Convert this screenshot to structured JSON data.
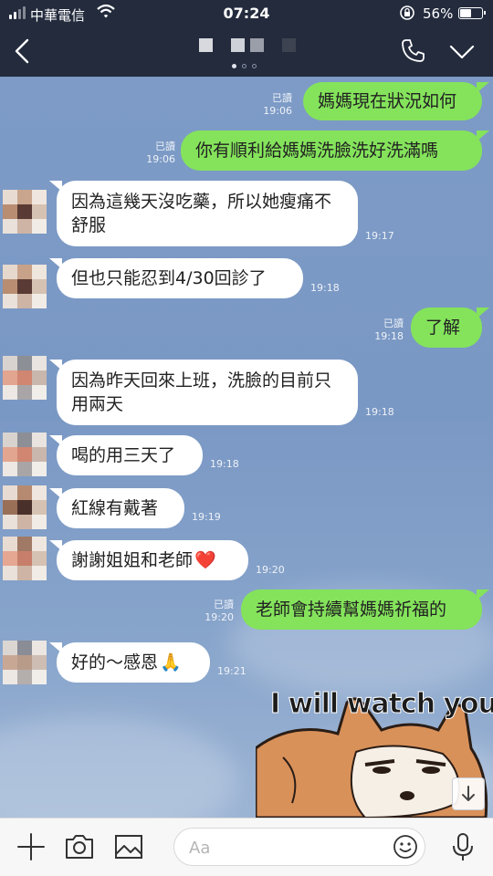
{
  "status": {
    "carrier": "中華電信",
    "time": "07:24",
    "battery_percent": "56%",
    "battery_level": 0.56
  },
  "header": {
    "contact_name": "",
    "page_indicator": {
      "count": 3,
      "active": 0
    }
  },
  "messages": [
    {
      "side": "me",
      "text": "媽媽現在狀況如何",
      "read": "已讀",
      "time": "19:06"
    },
    {
      "side": "me",
      "text": "你有順利給媽媽洗臉洗好洗滿嗎",
      "read": "已讀",
      "time": "19:06"
    },
    {
      "side": "them",
      "text": "因為這幾天沒吃藥，所以她瘦痛不舒服",
      "time": "19:17"
    },
    {
      "side": "them",
      "text": "但也只能忍到4/30回診了",
      "time": "19:18"
    },
    {
      "side": "me",
      "text": "了解",
      "read": "已讀",
      "time": "19:18"
    },
    {
      "side": "them",
      "text": "因為昨天回來上班，洗臉的目前只用兩天",
      "time": "19:18"
    },
    {
      "side": "them",
      "text": "喝的用三天了",
      "time": "19:18"
    },
    {
      "side": "them",
      "text": "紅線有戴著",
      "time": "19:19"
    },
    {
      "side": "them",
      "text": "謝謝姐姐和老師",
      "emoji": "❤️",
      "time": "19:20"
    },
    {
      "side": "me",
      "text": "老師會持續幫媽媽祈福的",
      "read": "已讀",
      "time": "19:20"
    },
    {
      "side": "them",
      "text": "好的～感恩",
      "emoji": "🙏",
      "time": "19:21"
    }
  ],
  "sticker": {
    "caption": "I will watch you"
  },
  "composer": {
    "placeholder": "Aa"
  },
  "icons": {
    "back": "chevron-left-icon",
    "call": "phone-icon",
    "menu": "chevron-down-icon",
    "add": "plus-icon",
    "camera": "camera-icon",
    "image": "image-icon",
    "emoji": "smiley-icon",
    "mic": "microphone-icon",
    "scroll": "arrow-down-icon"
  },
  "colors": {
    "header_bg": "#232b3d",
    "my_bubble": "#84e35b",
    "their_bubble": "#ffffff",
    "chat_bg": "#7d9bc6"
  }
}
